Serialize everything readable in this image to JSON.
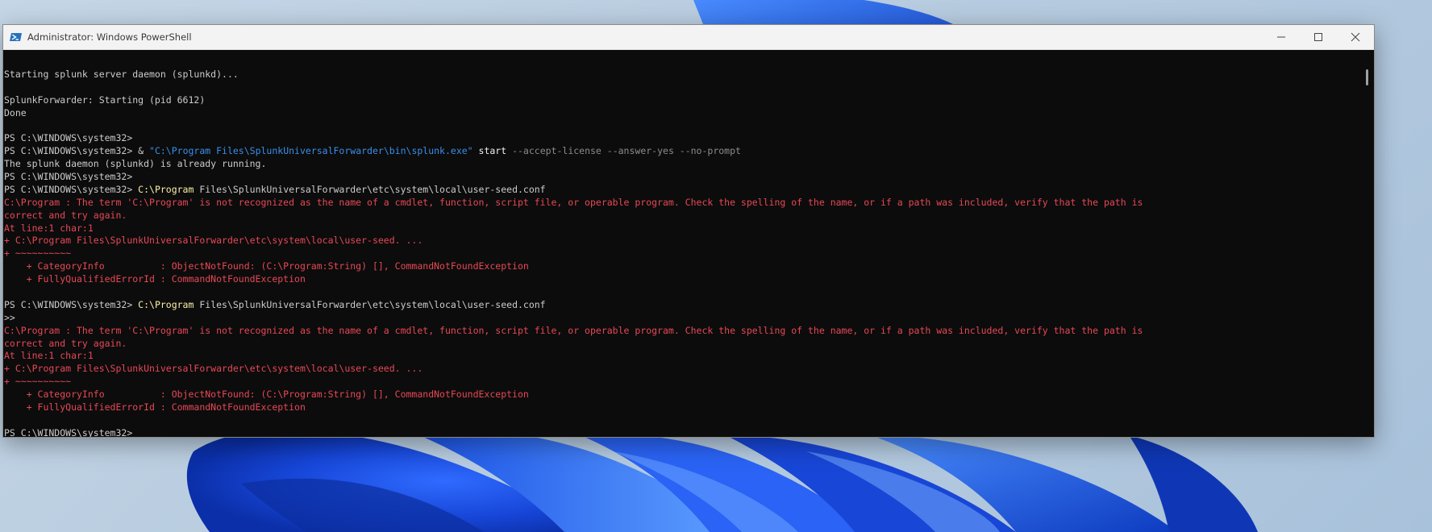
{
  "window": {
    "title": "Administrator: Windows PowerShell",
    "icon": "powershell-icon",
    "controls": [
      "minimize-icon",
      "maximize-icon",
      "close-icon"
    ]
  },
  "colors": {
    "background": "#0c0c0c",
    "text": "#cccccc",
    "error": "#e74856",
    "command": "#f9f1a5",
    "string": "#3b8eea",
    "parameter": "#8c8c8c"
  },
  "console": {
    "lines": [
      [],
      [
        {
          "t": "Starting splunk server daemon (splunkd)...",
          "c": "w"
        }
      ],
      [],
      [
        {
          "t": "SplunkForwarder: Starting (pid 6612)",
          "c": "w"
        }
      ],
      [
        {
          "t": "Done",
          "c": "w"
        }
      ],
      [],
      [
        {
          "t": "PS C:\\WINDOWS\\system32> ",
          "c": "w"
        }
      ],
      [
        {
          "t": "PS C:\\WINDOWS\\system32> ",
          "c": "w"
        },
        {
          "t": "& ",
          "c": "w"
        },
        {
          "t": "\"C:\\Program Files\\SplunkUniversalForwarder\\bin\\splunk.exe\"",
          "c": "b"
        },
        {
          "t": " start ",
          "c": "bright"
        },
        {
          "t": "--accept-license --answer-yes --no-prompt",
          "c": "g"
        }
      ],
      [
        {
          "t": "The splunk daemon (splunkd) is already running.",
          "c": "w"
        }
      ],
      [
        {
          "t": "PS C:\\WINDOWS\\system32> ",
          "c": "w"
        }
      ],
      [
        {
          "t": "PS C:\\WINDOWS\\system32> ",
          "c": "w"
        },
        {
          "t": "C:\\Program",
          "c": "y"
        },
        {
          "t": " Files\\SplunkUniversalForwarder\\etc\\system\\local\\user-seed.conf",
          "c": "w"
        }
      ],
      [
        {
          "t": "C:\\Program : The term 'C:\\Program' is not recognized as the name of a cmdlet, function, script file, or operable program. Check the spelling of the name, or if a path was included, verify that the path is",
          "c": "r"
        }
      ],
      [
        {
          "t": "correct and try again.",
          "c": "r"
        }
      ],
      [
        {
          "t": "At line:1 char:1",
          "c": "r"
        }
      ],
      [
        {
          "t": "+ C:\\Program Files\\SplunkUniversalForwarder\\etc\\system\\local\\user-seed. ...",
          "c": "r"
        }
      ],
      [
        {
          "t": "+ ~~~~~~~~~~",
          "c": "r"
        }
      ],
      [
        {
          "t": "    + CategoryInfo          : ObjectNotFound: (C:\\Program:String) [], CommandNotFoundException",
          "c": "r"
        }
      ],
      [
        {
          "t": "    + FullyQualifiedErrorId : CommandNotFoundException",
          "c": "r"
        }
      ],
      [],
      [
        {
          "t": "PS C:\\WINDOWS\\system32> ",
          "c": "w"
        },
        {
          "t": "C:\\Program",
          "c": "y"
        },
        {
          "t": " Files\\SplunkUniversalForwarder\\etc\\system\\local\\user-seed.conf",
          "c": "w"
        }
      ],
      [
        {
          "t": ">>",
          "c": "w"
        }
      ],
      [
        {
          "t": "C:\\Program : The term 'C:\\Program' is not recognized as the name of a cmdlet, function, script file, or operable program. Check the spelling of the name, or if a path was included, verify that the path is",
          "c": "r"
        }
      ],
      [
        {
          "t": "correct and try again.",
          "c": "r"
        }
      ],
      [
        {
          "t": "At line:1 char:1",
          "c": "r"
        }
      ],
      [
        {
          "t": "+ C:\\Program Files\\SplunkUniversalForwarder\\etc\\system\\local\\user-seed. ...",
          "c": "r"
        }
      ],
      [
        {
          "t": "+ ~~~~~~~~~~",
          "c": "r"
        }
      ],
      [
        {
          "t": "    + CategoryInfo          : ObjectNotFound: (C:\\Program:String) [], CommandNotFoundException",
          "c": "r"
        }
      ],
      [
        {
          "t": "    + FullyQualifiedErrorId : CommandNotFoundException",
          "c": "r"
        }
      ],
      [],
      [
        {
          "t": "PS C:\\WINDOWS\\system32> ",
          "c": "w"
        }
      ]
    ]
  }
}
